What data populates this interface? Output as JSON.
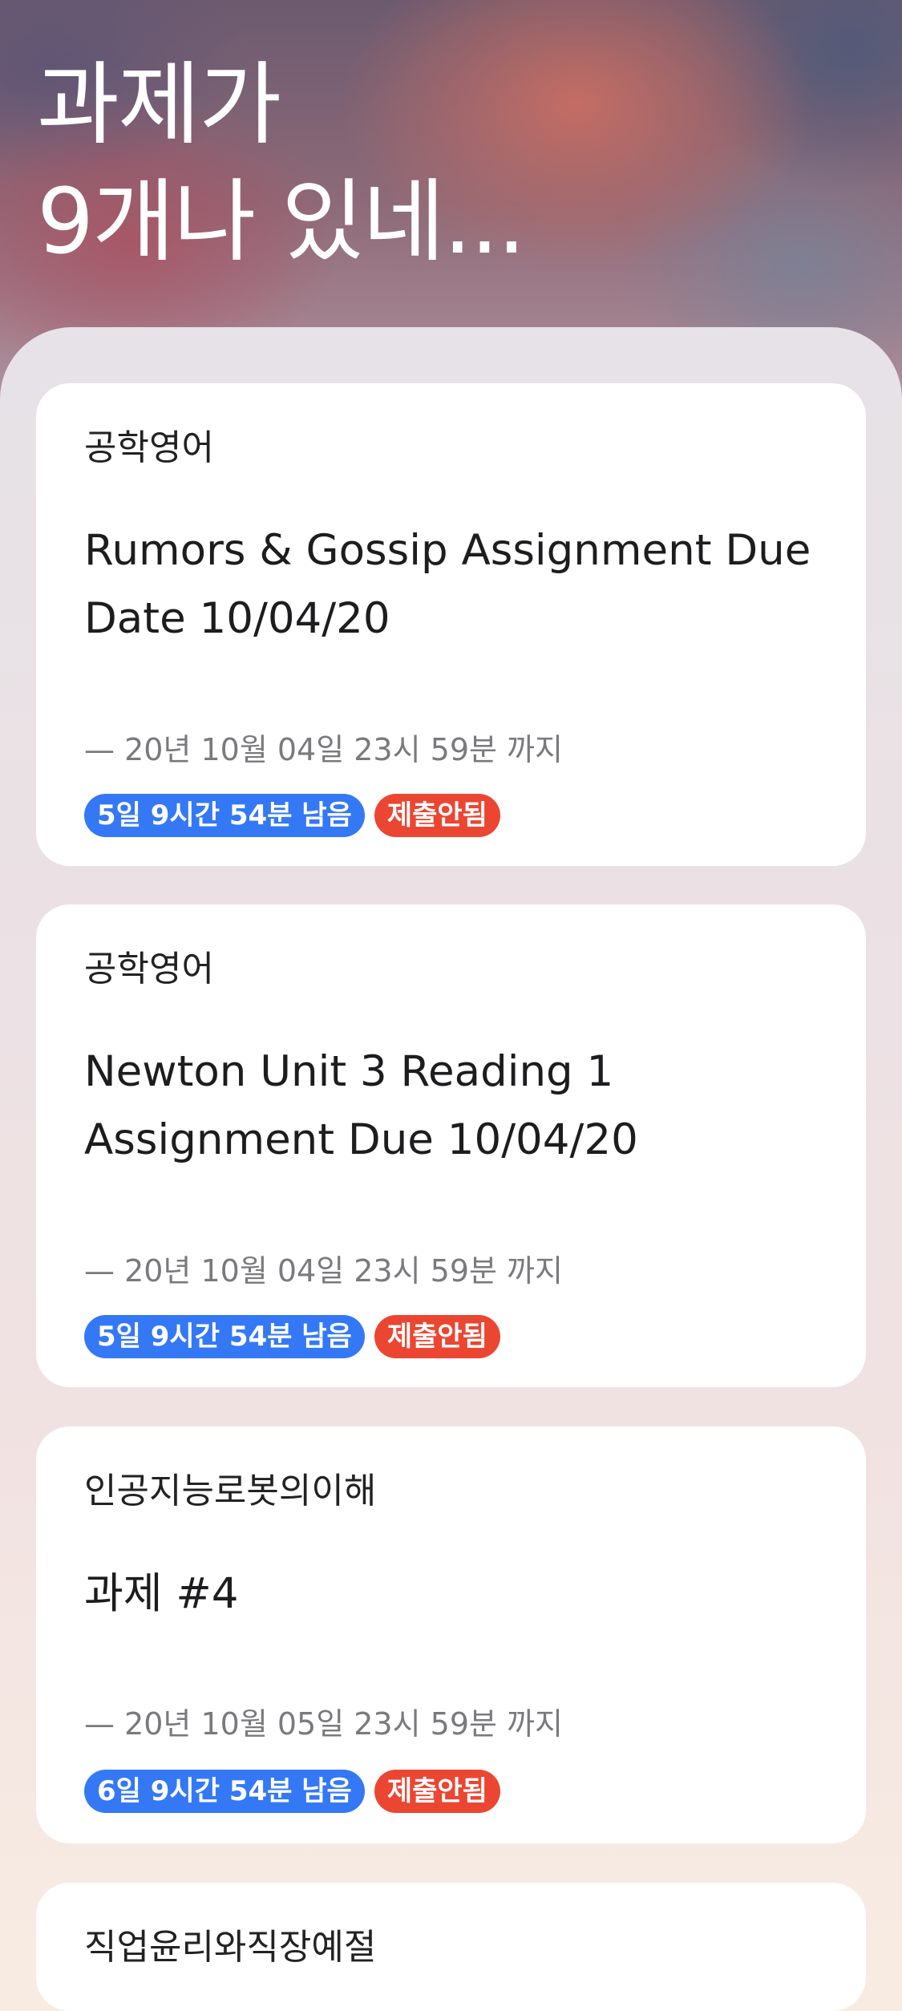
{
  "header": {
    "title_line1": "과제가",
    "title_line2": "9개나 있네..."
  },
  "colors": {
    "remaining_badge": "#3478f6",
    "status_badge": "#eb4632"
  },
  "assignments": [
    {
      "course": "공학영어",
      "title": "Rumors & Gossip Assignment Due Date 10/04/20",
      "due": "— 20년 10월 04일 23시 59분 까지",
      "remaining": "5일 9시간 54분 남음",
      "status": "제출안됨"
    },
    {
      "course": "공학영어",
      "title": "Newton Unit 3 Reading 1 Assignment Due 10/04/20",
      "due": "— 20년 10월 04일 23시 59분 까지",
      "remaining": "5일 9시간 54분 남음",
      "status": "제출안됨"
    },
    {
      "course": "인공지능로봇의이해",
      "title": "과제 #4",
      "due": "— 20년 10월 05일 23시 59분 까지",
      "remaining": "6일 9시간 54분 남음",
      "status": "제출안됨"
    },
    {
      "course": "직업윤리와직장예절"
    }
  ]
}
